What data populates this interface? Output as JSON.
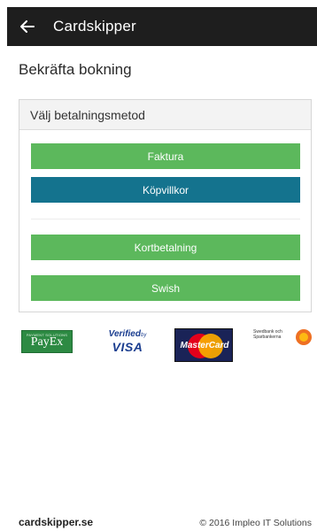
{
  "header": {
    "title": "Cardskipper",
    "back_icon": "arrow-left-icon"
  },
  "page": {
    "title": "Bekräfta bokning"
  },
  "payment_panel": {
    "heading": "Välj betalningsmetod",
    "buttons": [
      {
        "label": "Faktura",
        "color": "#5cb85c"
      },
      {
        "label": "Köpvillkor",
        "color": "#14738e"
      },
      {
        "label": "Kortbetalning",
        "color": "#5cb85c"
      },
      {
        "label": "Swish",
        "color": "#5cb85c"
      }
    ]
  },
  "logos": {
    "payex": "PayEx",
    "payex_tagline": "PAYMENT SOLUTIONS",
    "visa_line1": "Verified",
    "visa_by": "by",
    "visa_line2": "VISA",
    "mastercard": "MasterCard",
    "swedbank": "Swedbank och Sparbankerna"
  },
  "footer": {
    "brand": "cardskipper.se",
    "copyright": "© 2016 Impleo IT Solutions"
  },
  "colors": {
    "appbar": "#1e1e1e",
    "green": "#5cb85c",
    "blue": "#14738e"
  }
}
